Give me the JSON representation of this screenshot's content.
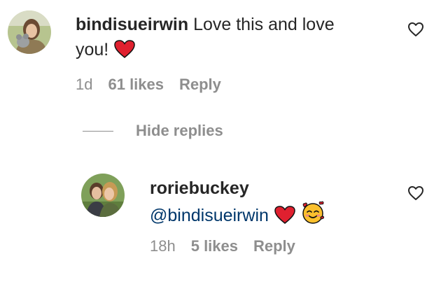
{
  "comments": [
    {
      "username": "bindisueirwin",
      "text_line1": "Love this and love",
      "text_line2": "you!",
      "time": "1d",
      "likes": "61 likes",
      "reply_label": "Reply"
    }
  ],
  "replies_toggle": {
    "label": "Hide replies"
  },
  "replies": [
    {
      "username": "roriebuckey",
      "mention": "@bindisueirwin",
      "time": "18h",
      "likes": "5 likes",
      "reply_label": "Reply"
    }
  ],
  "icons": {
    "like": "heart-outline-icon",
    "emoji_heart": "red-heart-emoji",
    "emoji_smile": "smiling-face-with-hearts-emoji"
  },
  "colors": {
    "text": "#262626",
    "secondary": "#8e8e8e",
    "mention": "#00376b",
    "emoji_red": "#e0202f"
  }
}
